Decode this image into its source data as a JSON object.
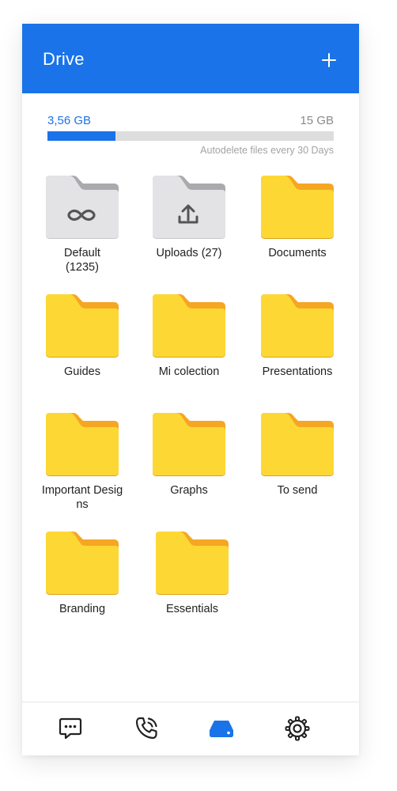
{
  "header": {
    "title": "Drive",
    "add_icon": "plus-icon"
  },
  "storage": {
    "used": "3,56 GB",
    "total": "15 GB",
    "used_fraction": 0.2373,
    "note": "Autodelete files every 30 Days"
  },
  "colors": {
    "primary": "#1A73E8",
    "folder_front": "#FDD835",
    "folder_back": "#F5A623",
    "system_front": "#E3E3E6",
    "system_back": "#A9A9AE"
  },
  "folders": [
    {
      "name": "Default\n(1235)",
      "type": "system",
      "icon": "infinity-icon"
    },
    {
      "name": "Uploads (27)",
      "type": "system",
      "icon": "upload-icon"
    },
    {
      "name": "Documents",
      "type": "regular",
      "icon": ""
    },
    {
      "name": "Guides",
      "type": "regular",
      "icon": ""
    },
    {
      "name": "Mi colection",
      "type": "regular",
      "icon": ""
    },
    {
      "name": "Presentations",
      "type": "regular",
      "icon": ""
    },
    {
      "name": "Important Designs",
      "type": "regular",
      "icon": ""
    },
    {
      "name": "Graphs",
      "type": "regular",
      "icon": ""
    },
    {
      "name": "To send",
      "type": "regular",
      "icon": ""
    },
    {
      "name": "Branding",
      "type": "regular",
      "icon": ""
    },
    {
      "name": "Essentials",
      "type": "regular",
      "icon": ""
    }
  ],
  "nav": [
    {
      "name": "chat",
      "icon": "chat-bubble-icon",
      "active": false
    },
    {
      "name": "calls",
      "icon": "phone-call-icon",
      "active": false
    },
    {
      "name": "drive",
      "icon": "drive-icon",
      "active": true
    },
    {
      "name": "settings",
      "icon": "gear-icon",
      "active": false
    }
  ]
}
